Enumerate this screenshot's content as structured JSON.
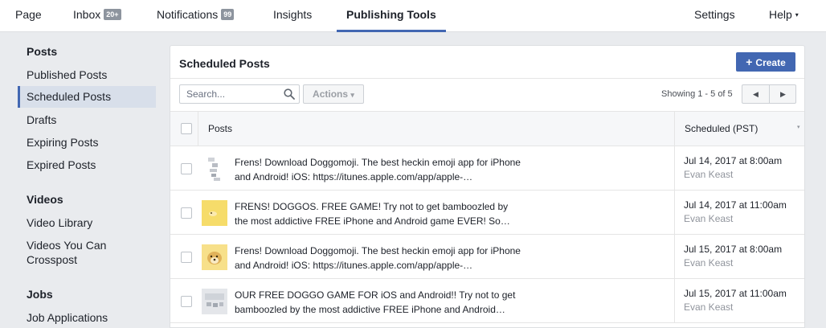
{
  "topnav": {
    "page": "Page",
    "inbox": "Inbox",
    "inbox_badge": "20+",
    "notifications": "Notifications",
    "notifications_badge": "99",
    "insights": "Insights",
    "publishing_tools": "Publishing Tools",
    "settings": "Settings",
    "help": "Help",
    "help_caret": "▾"
  },
  "sidebar": {
    "posts_heading": "Posts",
    "posts_items": [
      "Published Posts",
      "Scheduled Posts",
      "Drafts",
      "Expiring Posts",
      "Expired Posts"
    ],
    "active_item": "Scheduled Posts",
    "videos_heading": "Videos",
    "videos_items": [
      "Video Library",
      "Videos You Can Crosspost"
    ],
    "jobs_heading": "Jobs",
    "jobs_items": [
      "Job Applications"
    ]
  },
  "panel": {
    "title": "Scheduled Posts",
    "create_icon": "+",
    "create_label": "Create",
    "search_placeholder": "Search...",
    "actions_label": "Actions",
    "actions_caret": "▾",
    "showing": "Showing 1 - 5 of 5",
    "prev_icon": "◀",
    "next_icon": "▶"
  },
  "table": {
    "col_posts": "Posts",
    "col_scheduled": "Scheduled (PST)",
    "sort_caret": "▾",
    "rows": [
      {
        "text": "Frens! Download Doggomoji. The best heckin emoji app for iPhone and Android! iOS: https://itunes.apple.com/app/apple-…",
        "date": "Jul 14, 2017 at 8:00am",
        "author": "Evan Keast",
        "thumb": "doggomoji-grid-thumbnail"
      },
      {
        "text": "FRENS! DOGGOS. FREE GAME! Try not to get bamboozled by the most addictive FREE iPhone and Android game EVER! So…",
        "date": "Jul 14, 2017 at 11:00am",
        "author": "Evan Keast",
        "thumb": "yellow-doggo-thumbnail"
      },
      {
        "text": "Frens! Download Doggomoji. The best heckin emoji app for iPhone and Android! iOS: https://itunes.apple.com/app/apple-…",
        "date": "Jul 15, 2017 at 8:00am",
        "author": "Evan Keast",
        "thumb": "doge-face-thumbnail"
      },
      {
        "text": "OUR FREE DOGGO GAME FOR iOS and Android!! Try not to get bamboozled by the most addictive FREE iPhone and Android…",
        "date": "Jul 15, 2017 at 11:00am",
        "author": "Evan Keast",
        "thumb": "doggo-game-grey-thumbnail"
      }
    ]
  },
  "colors": {
    "accent": "#4267b2",
    "background": "#e9ebee",
    "muted_text": "#90949c"
  }
}
